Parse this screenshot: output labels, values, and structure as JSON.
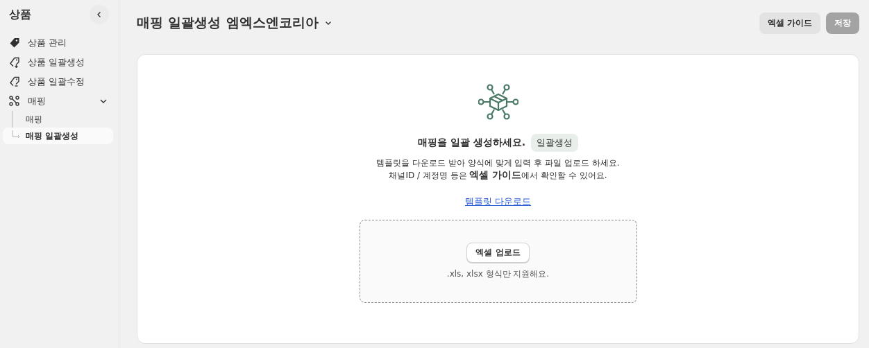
{
  "sidebar": {
    "title": "상품",
    "items": [
      {
        "label": "상품 관리",
        "kind": "tag",
        "selected": false
      },
      {
        "label": "상품 일괄생성",
        "kind": "create",
        "selected": false
      },
      {
        "label": "상품 일괄수정",
        "kind": "edit",
        "selected": false
      },
      {
        "label": "매핑",
        "kind": "mapping",
        "selected": false,
        "expanded": true,
        "children": [
          {
            "label": "매핑",
            "selected": false
          },
          {
            "label": "매핑 일괄생성",
            "selected": true
          }
        ]
      }
    ]
  },
  "header": {
    "title": "매핑 일괄생성",
    "subtitle": "엠엑스엔코리아",
    "buttons": [
      {
        "label": "엑셀 가이드",
        "disabled": false
      },
      {
        "label": "저장",
        "disabled": true
      }
    ]
  },
  "card": {
    "heading": "매핑을 일괄 생성하세요.",
    "badge": "일괄생성",
    "lines": [
      "템플릿을 다운로드 받아 양식에 맞게 입력 후 파일 업로드 하세요.",
      "채널ID / 계정명 등은 **엑셀 가이드**에서 확인할 수 있어요."
    ],
    "link": "템플릿 다운로드",
    "upload": {
      "button": "엑셀 업로드",
      "hint": ".xls, xlsx 형식만 지원해요."
    }
  }
}
